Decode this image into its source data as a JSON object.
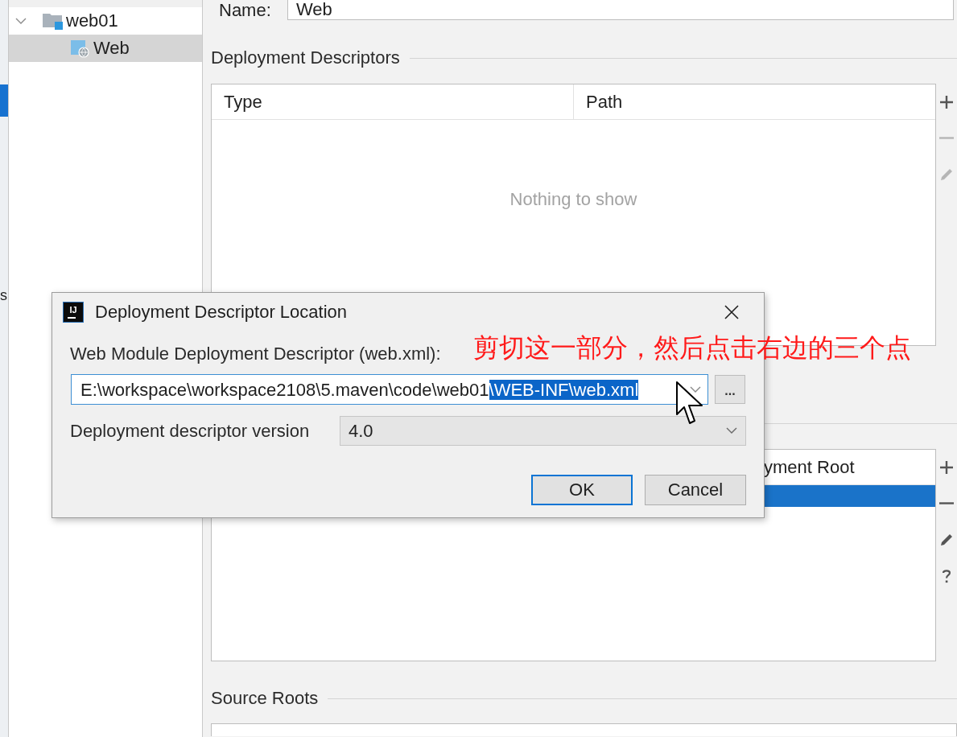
{
  "left_strip": {
    "items": [
      {
        "selected": true
      },
      {
        "label": "s",
        "selected": false
      }
    ]
  },
  "tree": {
    "items": [
      {
        "label": "web01",
        "expanded": true,
        "selected": false,
        "children": [
          {
            "label": "Web",
            "selected": true
          }
        ]
      }
    ]
  },
  "name_field": {
    "label": "Name:",
    "value": "Web"
  },
  "deployment_descriptors": {
    "title": "Deployment Descriptors",
    "columns": [
      "Type",
      "Path"
    ],
    "empty_text": "Nothing to show",
    "toolbar": [
      {
        "kind": "add",
        "disabled": false
      },
      {
        "kind": "remove",
        "disabled": true
      },
      {
        "kind": "edit",
        "disabled": true
      }
    ]
  },
  "web_resource_directories": {
    "columns": [
      "yment Root"
    ],
    "rows": [
      {
        "selected": true
      }
    ],
    "toolbar": [
      {
        "kind": "add",
        "disabled": false
      },
      {
        "kind": "remove",
        "disabled": false
      },
      {
        "kind": "edit",
        "disabled": false
      },
      {
        "kind": "help",
        "disabled": false
      }
    ]
  },
  "source_roots": {
    "title": "Source Roots"
  },
  "dialog": {
    "icon_text": "IJ",
    "title": "Deployment Descriptor Location",
    "descriptor_label": "Web Module Deployment Descriptor (web.xml):",
    "path_parts": [
      {
        "text": "E:\\workspace\\workspace2108\\5.maven\\code\\web01",
        "selected": false
      },
      {
        "text": "\\WEB-INF\\web.xml",
        "selected": true
      }
    ],
    "browse_label": "...",
    "version_label": "Deployment descriptor version",
    "version": "4.0",
    "buttons": [
      {
        "label": "OK",
        "default": true
      },
      {
        "label": "Cancel",
        "default": false
      }
    ]
  },
  "annotation": {
    "text": "剪切这一部分，然后点击右边的三个点"
  }
}
